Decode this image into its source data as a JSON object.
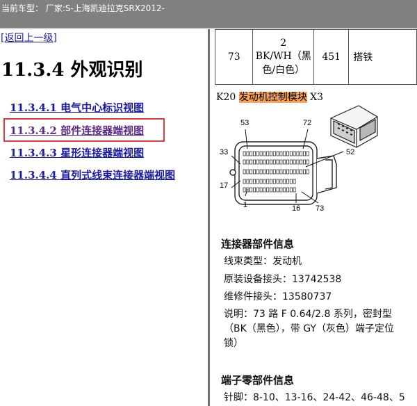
{
  "topbar": {
    "title": "当前车型：  厂家:S-上海凯迪拉克SRX2012-"
  },
  "nav": {
    "back_label": "[返回上一级]",
    "heading": "11.3.4 外观识别",
    "links": [
      {
        "label": "11.3.4.1  电气中心标识视图"
      },
      {
        "label": "11.3.4.2  部件连接器端视图"
      },
      {
        "label": "11.3.4.3  星形连接器端视图"
      },
      {
        "label": "11.3.4.4  直列式线束连接器端视图"
      }
    ]
  },
  "terminal_row": {
    "pin": "73",
    "color_code": "2",
    "color_desc_1": "BK/WH（黑",
    "color_desc_2": "色/白色）",
    "circuit": "451",
    "function": "搭铁"
  },
  "connector": {
    "prefix": "K20 ",
    "name": "发动机控制模块",
    "suffix": " X3",
    "pin_labels": {
      "p53": "53",
      "p72": "72",
      "p33": "33",
      "p52": "52",
      "p17": "17",
      "p1": "1",
      "p16": "16",
      "p73": "73"
    }
  },
  "parts_info": {
    "title": "连接器部件信息",
    "harness_type": "线束类型：发动机",
    "oem_connector": "原装设备接头：13742538",
    "service_connector": "维修件接头：13580737",
    "desc_1": "说明：73 路 F 0.64/2.8 系列，密封型",
    "desc_2": "（BK（黑色），带 GY（灰色）端子定位",
    "desc_3": "锁）"
  },
  "terminal_info": {
    "title": "端子零部件信息",
    "pins_line": "针脚：8-10、13-16、24-42、46-48、5"
  },
  "colors": {
    "topbar": "#808080",
    "link": "#1a1aa6",
    "visited": "#5b2a86",
    "highlight_box": "#e23a3a",
    "module_highlight": "#f5a25a"
  }
}
